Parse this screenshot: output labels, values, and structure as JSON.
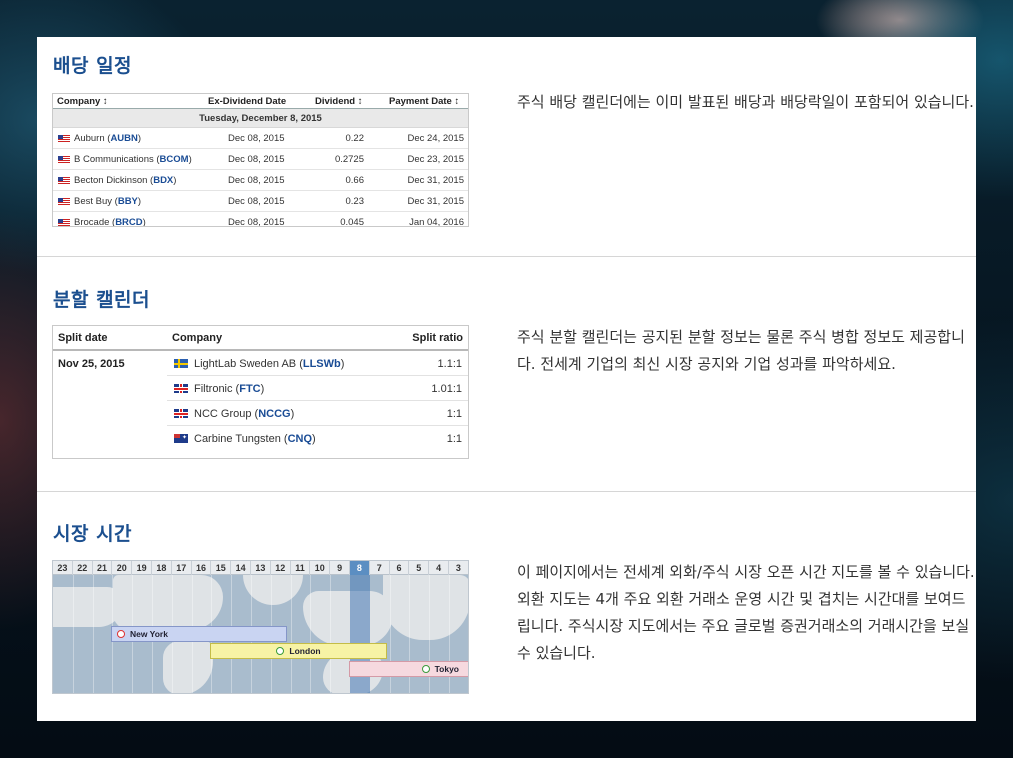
{
  "sections": {
    "dividend": {
      "title": "배당 일정",
      "description": "주식 배당 캘린더에는 이미 발표된 배당과 배당락일이 포함되어 있습니다.",
      "table": {
        "headers": [
          "Company ↕",
          "Ex-Dividend Date",
          "Dividend ↕",
          "Payment Date ↕"
        ],
        "group_date": "Tuesday, December 8, 2015",
        "rows": [
          {
            "name": "Auburn (",
            "ticker": "AUBN",
            "close": ")",
            "ex_date": "Dec 08, 2015",
            "dividend": "0.22",
            "payment": "Dec 24, 2015"
          },
          {
            "name": "B Communications (",
            "ticker": "BCOM",
            "close": ")",
            "ex_date": "Dec 08, 2015",
            "dividend": "0.2725",
            "payment": "Dec 23, 2015"
          },
          {
            "name": "Becton Dickinson (",
            "ticker": "BDX",
            "close": ")",
            "ex_date": "Dec 08, 2015",
            "dividend": "0.66",
            "payment": "Dec 31, 2015"
          },
          {
            "name": "Best Buy (",
            "ticker": "BBY",
            "close": ")",
            "ex_date": "Dec 08, 2015",
            "dividend": "0.23",
            "payment": "Dec 31, 2015"
          },
          {
            "name": "Brocade (",
            "ticker": "BRCD",
            "close": ")",
            "ex_date": "Dec 08, 2015",
            "dividend": "0.045",
            "payment": "Jan 04, 2016"
          }
        ]
      }
    },
    "split": {
      "title": "분할 캘린더",
      "description": "주식 분할 캘린더는 공지된 분할 정보는 물론 주식 병합 정보도 제공합니다. 전세계 기업의 최신 시장 공지와 기업 성과를 파악하세요.",
      "table": {
        "headers": [
          "Split date",
          "Company",
          "Split ratio"
        ],
        "date": "Nov 25, 2015",
        "rows": [
          {
            "flag": "sweden-flag",
            "name": "LightLab Sweden AB (",
            "ticker": "LLSWb",
            "close": ")",
            "ratio": "1.1:1"
          },
          {
            "flag": "uk-flag",
            "name": "Filtronic (",
            "ticker": "FTC",
            "close": ")",
            "ratio": "1.01:1"
          },
          {
            "flag": "uk-flag",
            "name": "NCC Group (",
            "ticker": "NCCG",
            "close": ")",
            "ratio": "1:1"
          },
          {
            "flag": "australia-flag",
            "name": "Carbine Tungsten (",
            "ticker": "CNQ",
            "close": ")",
            "ratio": "1:1"
          }
        ]
      }
    },
    "hours": {
      "title": "시장 시간",
      "description": "이 페이지에서는 전세계 외화/주식 시장 오픈 시간 지도를 볼 수 있습니다. 외환 지도는 4개 주요 외환 거래소 운영 시간 및 겹치는 시간대를 보여드립니다. 주식시장 지도에서는 주요 글로벌 증권거래소의 거래시간을 보실 수 있습니다.",
      "hour_labels": [
        "23",
        "22",
        "21",
        "20",
        "19",
        "18",
        "17",
        "16",
        "15",
        "14",
        "13",
        "12",
        "11",
        "10",
        "9",
        "8",
        "7",
        "6",
        "5",
        "4",
        "3"
      ],
      "current_hour": "8",
      "markets": [
        "New York",
        "London",
        "Tokyo"
      ]
    }
  },
  "colors": {
    "title_blue": "#1b4f8f",
    "ticker_blue": "#1a4c95",
    "current_hour": "#5b8ec2"
  }
}
